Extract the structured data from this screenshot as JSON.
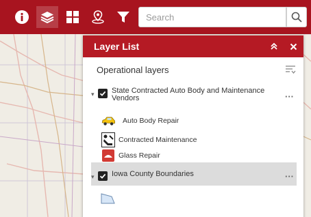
{
  "toolbar": {
    "buttons": [
      {
        "icon": "info-icon"
      },
      {
        "icon": "layers-icon"
      },
      {
        "icon": "grid-icon"
      },
      {
        "icon": "location-pin-icon"
      },
      {
        "icon": "filter-icon"
      }
    ],
    "search": {
      "placeholder": "Search",
      "value": ""
    },
    "colors": {
      "toolbar_bg": "#a8141f",
      "panel_header_bg": "#b51a24"
    }
  },
  "layer_list": {
    "title": "Layer List",
    "section_title": "Operational layers",
    "layers": [
      {
        "name": "State Contracted Auto Body and Maintenance Vendors",
        "checked": true,
        "legend": [
          {
            "icon": "car-icon",
            "label": "Auto Body Repair"
          },
          {
            "icon": "mechanic-icon",
            "label": "Contracted Maintenance"
          },
          {
            "icon": "windshield-icon",
            "label": "Glass Repair"
          }
        ]
      },
      {
        "name": "Iowa County Boundaries",
        "checked": true,
        "legend": [
          {
            "icon": "polygon-icon",
            "label": ""
          }
        ]
      }
    ]
  }
}
